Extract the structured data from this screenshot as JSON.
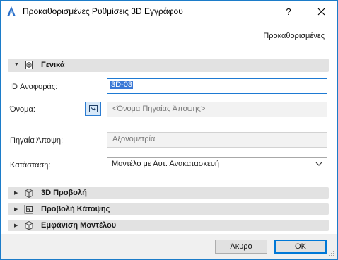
{
  "window": {
    "title": "Προκαθορισμένες Ρυθμίσεις 3D Εγγράφου",
    "help_label": "?",
    "close_label": "✕"
  },
  "defaults_label": "Προκαθορισμένες",
  "sections": {
    "general": {
      "label": "Γενικά",
      "icon": "document-3d-icon",
      "expanded": true
    },
    "view3d": {
      "label": "3D Προβολή",
      "icon": "3d-box-icon",
      "expanded": false
    },
    "floor_plan": {
      "label": "Προβολή Κάτοψης",
      "icon": "floor-plan-icon",
      "expanded": false
    },
    "model_display": {
      "label": "Εμφάνιση Μοντέλου",
      "icon": "cube-icon",
      "expanded": false
    }
  },
  "form": {
    "ref_id_label": "ID Αναφοράς:",
    "ref_id_value": "3D-03",
    "name_label": "Όνομα:",
    "name_value": "<Όνομα Πηγαίας Άποψης>",
    "source_view_label": "Πηγαία Άποψη:",
    "source_view_value": "Αξονομετρία",
    "status_label": "Κατάσταση:",
    "status_value": "Μοντέλο με Αυτ. Ανακατασκευή"
  },
  "buttons": {
    "cancel": "Άκυρο",
    "ok": "OK"
  },
  "colors": {
    "accent": "#1e7ad3",
    "selection": "#3a78d6",
    "section_bar": "#e2e2e2",
    "footer": "#f0f0f0"
  }
}
